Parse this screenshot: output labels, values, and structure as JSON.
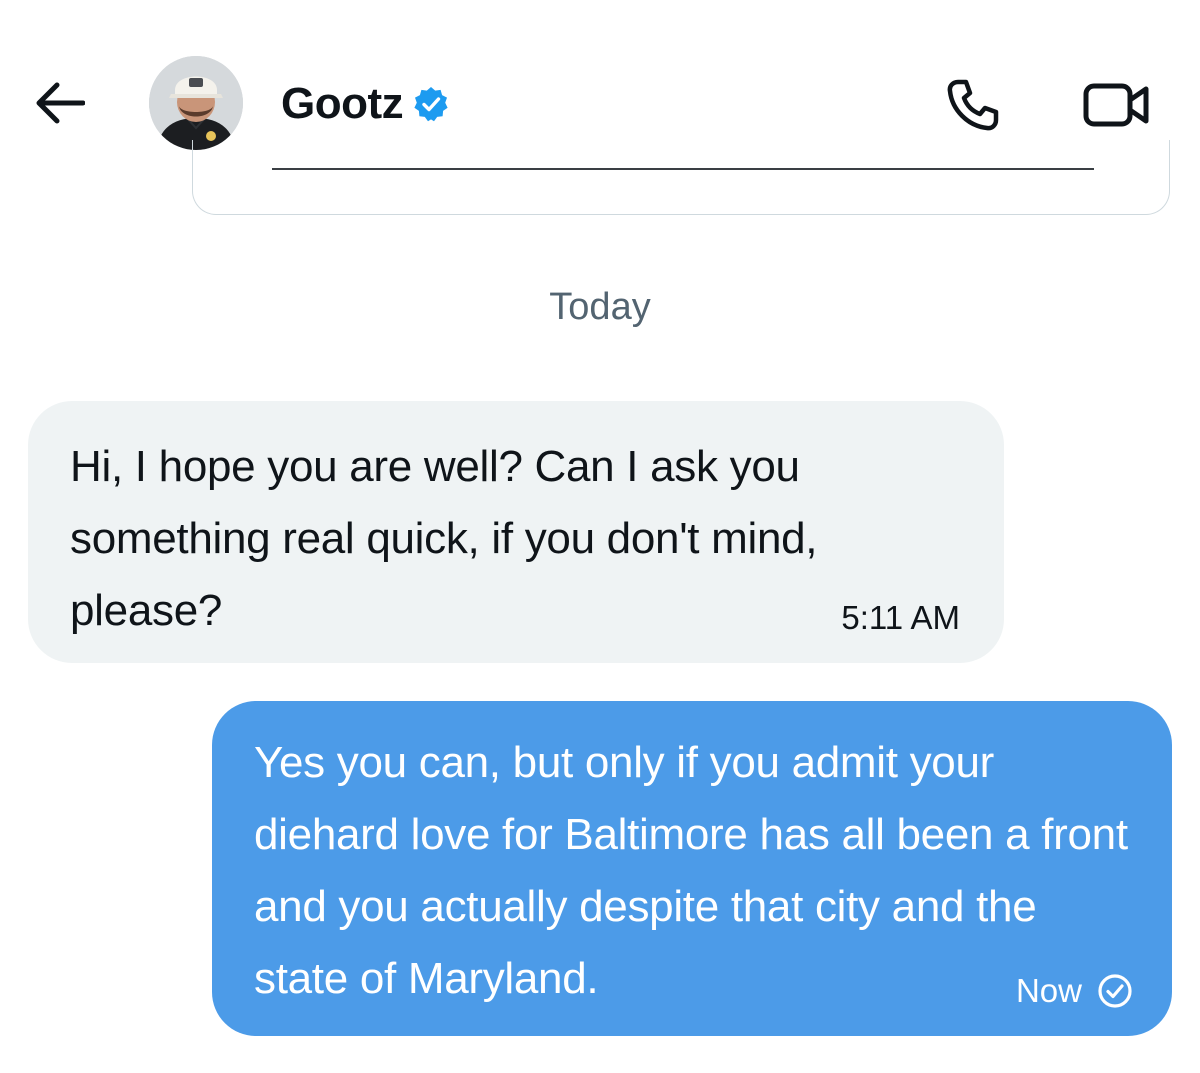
{
  "header": {
    "back_icon": "arrow-left-icon",
    "contact_name": "Gootz",
    "verified_icon": "verified-badge-icon",
    "verified_color": "#1d9bf0",
    "call_icon": "phone-icon",
    "video_icon": "video-camera-icon"
  },
  "conversation": {
    "date_separator": "Today",
    "messages": [
      {
        "direction": "incoming",
        "text": "Hi, I hope you are well? Can I ask you something real quick, if you don't mind, please?",
        "time": "5:11 AM",
        "bubble_color": "#eff3f4"
      },
      {
        "direction": "outgoing",
        "text": "Yes you can, but only if you admit your diehard love for Baltimore has all been a front and you actually despite that city and the state of Maryland.",
        "time": "Now",
        "status_icon": "sent-check-circle-icon",
        "bubble_color": "#4c9be8"
      }
    ]
  }
}
